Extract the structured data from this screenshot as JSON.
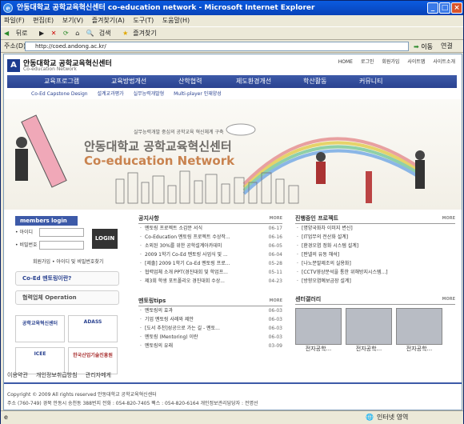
{
  "window": {
    "title": "안동대학교 공학교육혁신센터 co-education network - Microsoft Internet Explorer"
  },
  "menu": [
    "파일(F)",
    "편집(E)",
    "보기(V)",
    "즐겨찾기(A)",
    "도구(T)",
    "도움말(H)"
  ],
  "toolbar": {
    "back": "뒤로",
    "search": "검색",
    "favorites": "즐겨찾기"
  },
  "address": {
    "label": "주소(D)",
    "url": "http://coed.andong.ac.kr/",
    "go": "이동",
    "links": "연결"
  },
  "site": {
    "name": "안동대학교 공학교육혁신센터",
    "sub": "Co-education Network",
    "toplinks": [
      "HOME",
      "로그인",
      "회원가입",
      "사이트맵",
      "사이트소개"
    ],
    "nav": [
      "교육프로그램",
      "교육방법개선",
      "산학협력",
      "제도환경개선",
      "학산활동",
      "커뮤니티"
    ],
    "subnav": [
      "Co-Ed Capstone Design",
      "설계교과평가",
      "실무능력개발형",
      "Multi-player 인재양성"
    ],
    "hero_tagline": "실무능력개발 중심의 공학교육 혁신체계 구축",
    "hero_title": "안동대학교 공학교육혁신센터",
    "hero_en": "Co-education Network"
  },
  "login": {
    "header": "members login",
    "id_label": "• 아이디",
    "pw_label": "• 비밀번호",
    "button": "LOGIN",
    "links": "회원가입 • 아이디 및 비밀번호찾기"
  },
  "boxes": [
    "Co-Ed 멘토링이란?",
    "협력업체 Operation"
  ],
  "banners": [
    "공학교육혁신센터",
    "ADASS",
    "ICEE",
    "한국산업기술진흥원"
  ],
  "notice": {
    "title": "공지사항",
    "more": "MORE",
    "items": [
      {
        "t": "멘토링 프로젝트 소감문 서식",
        "d": "06-17"
      },
      {
        "t": "Co-Education 멘토링 프로젝트 수상작...",
        "d": "06-16"
      },
      {
        "t": "소외된 30%를 위한 공학설계아카데미",
        "d": "06-05"
      },
      {
        "t": "2009 1학기 Co-Ed 멘토링 사업식 및 ...",
        "d": "06-04"
      },
      {
        "t": "[제출] 2009 1학기 Co-Ed 멘토링 프로...",
        "d": "05-28"
      },
      {
        "t": "협력업체 소개 PPT(경진대회 및 학업프...",
        "d": "05-11"
      },
      {
        "t": "제3회 학생 포트폴리오 경진대회 수상...",
        "d": "04-23"
      }
    ]
  },
  "tips": {
    "title": "멘토링tips",
    "more": "MORE",
    "items": [
      {
        "t": "멘토링의 효과",
        "d": "06-03"
      },
      {
        "t": "기업 멘토링 사례와 제안",
        "d": "06-03"
      },
      {
        "t": "[도서 추천]성공으로 가는 길 - 멘토...",
        "d": "06-03"
      },
      {
        "t": "멘토링 (Mentoring) 이란",
        "d": "06-03"
      },
      {
        "t": "멘토링의 유래",
        "d": "03-09"
      }
    ]
  },
  "projects": {
    "title": "진행중인 프로젝트",
    "more": "MORE",
    "items": [
      "[명양국화차 이미지 변신]",
      "[IT업무의 전산화 설계]",
      "[환경오염 정화 시스템 설계]",
      "[판넬의 유동 해석]",
      "[나노분말제조의 실용화]",
      "[CCTV영상분석을 통한 위해방지시스템...]",
      "[방향오염예보금장 설계]"
    ]
  },
  "gallery": {
    "title": "센터갤러리",
    "more": "MORE",
    "captions": [
      "전자공학...",
      "전자공학...",
      "전자공학..."
    ]
  },
  "footer": {
    "links": [
      "이용약관",
      "개인정보취급방침",
      "관리자메게"
    ],
    "copyright": "Copyright © 2009 All rights reserved 안동대학교 공학교육혁신센터",
    "address": "주소 (760-749) 경북 안동시 송천동 388번지 전화 : 054-820-7405 팩스 : 054-820-6164 개인정보관리담당자 : 전명선"
  },
  "status": {
    "zone": "인터넷 영역"
  }
}
